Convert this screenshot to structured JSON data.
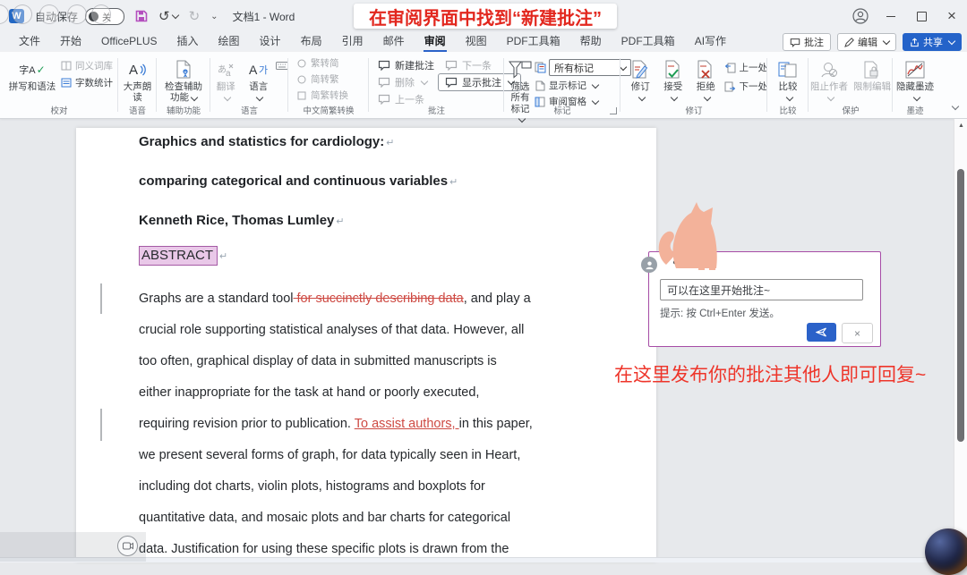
{
  "titlebar": {
    "autosave_label": "自动保存",
    "autosave_state": "关",
    "doc_title": "文档1 - Word"
  },
  "tabs": {
    "items": [
      "文件",
      "开始",
      "OfficePLUS",
      "插入",
      "绘图",
      "设计",
      "布局",
      "引用",
      "邮件",
      "审阅",
      "视图",
      "PDF工具箱",
      "帮助",
      "PDF工具箱",
      "AI写作"
    ],
    "active": "审阅",
    "right_buttons": {
      "comments": "批注",
      "edit": "编辑",
      "share": "共享"
    }
  },
  "ribbon": {
    "proofing": {
      "label": "校对",
      "spelling": "拼写和语法",
      "thesaurus": "同义词库",
      "word_count": "字数统计"
    },
    "speech": {
      "label": "语音",
      "read_aloud": "大声朗读"
    },
    "accessibility": {
      "label": "辅助功能",
      "check": "检查辅助功能"
    },
    "language": {
      "label": "语言",
      "translate": "翻译",
      "language_btn": "语言"
    },
    "chinese": {
      "label": "中文简繁转换",
      "t2s": "繁转简",
      "s2t": "简转繁",
      "convert": "简繁转换"
    },
    "comments": {
      "label": "批注",
      "new_comment": "新建批注",
      "next": "下一条",
      "delete": "删除",
      "show_comments": "显示批注",
      "previous": "上一条"
    },
    "tracking": {
      "label": "标记",
      "filter": "筛选所有标记",
      "markup_value": "所有标记",
      "show_markup": "显示标记",
      "reviewing_pane": "审阅窗格"
    },
    "changes": {
      "label": "修订",
      "track": "修订",
      "accept": "接受",
      "reject": "拒绝",
      "prev": "上一处",
      "next": "下一处"
    },
    "compare": {
      "label": "比较",
      "compare_btn": "比较"
    },
    "protect": {
      "label": "保护",
      "block_authors": "阻止作者",
      "restrict": "限制编辑"
    },
    "ink": {
      "label": "墨迹",
      "hide_ink": "隐藏墨迹"
    }
  },
  "document": {
    "heading1": "Graphics and statistics for cardiology:",
    "heading2": "comparing categorical and continuous variables",
    "authors": "Kenneth Rice, Thomas Lumley",
    "abstract_label": "ABSTRACT",
    "pilcrow": "↵",
    "paragraph_lines": [
      [
        {
          "t": "Graphs are a standard tool",
          "s": "n"
        },
        {
          "t": " for succinctly describing data",
          "s": "d"
        },
        {
          "t": ", and play a",
          "s": "n"
        }
      ],
      [
        {
          "t": "crucial role supporting statistical analyses of that data. However, all",
          "s": "n"
        }
      ],
      [
        {
          "t": "too often, graphical display of data in submitted manuscripts is",
          "s": "n"
        }
      ],
      [
        {
          "t": "either inappropriate for the task at hand or poorly executed,",
          "s": "n"
        }
      ],
      [
        {
          "t": "requiring revision prior to publication. ",
          "s": "n"
        },
        {
          "t": "To assist authors, ",
          "s": "i"
        },
        {
          "t": "in this paper,",
          "s": "n"
        }
      ],
      [
        {
          "t": "we present several forms of graph, for data typically seen in Heart,",
          "s": "n"
        }
      ],
      [
        {
          "t": "including dot charts, violin plots, histograms and boxplots for",
          "s": "n"
        }
      ],
      [
        {
          "t": "quantitative data, and mosaic plots and bar charts for categorical",
          "s": "n"
        }
      ],
      [
        {
          "t": "data. Justification for using these specific plots is drawn from the",
          "s": "n"
        }
      ]
    ]
  },
  "comment_card": {
    "input_value": "可以在这里开始批注~",
    "hint": "提示: 按 Ctrl+Enter 发送。"
  },
  "annotations": {
    "top": "在审阅界面中找到“新建批注”",
    "middle": "在这里发布你的批注其他人即可回复~"
  },
  "colors": {
    "share_blue": "#2463c9",
    "annotation_red": "#e8352b",
    "comment_border_purple": "#a64ca6",
    "abstract_highlight": "#e9c8e8",
    "track_change_red": "#ce4a43",
    "cat_peach": "#f3b29a",
    "save_icon_purple": "#b44fbe",
    "active_tab_blue": "#2b62c9"
  }
}
